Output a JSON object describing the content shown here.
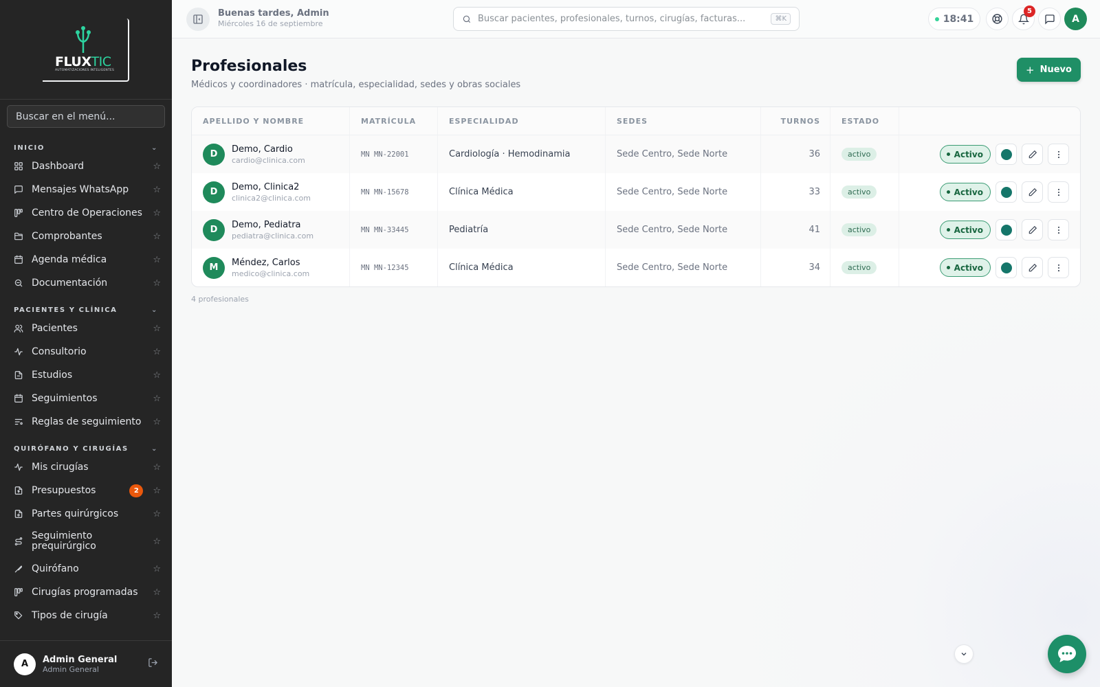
{
  "sidebar": {
    "logo": {
      "brand_a": "FLUX",
      "brand_b": "TIC",
      "tagline": "AUTOMATIZACIONES INTELIGENTES"
    },
    "menu_search_placeholder": "Buscar en el menú...",
    "sections": [
      {
        "title": "INICIO",
        "items": [
          {
            "label": "Dashboard",
            "icon": "grid-icon"
          },
          {
            "label": "Mensajes WhatsApp",
            "icon": "message-icon"
          },
          {
            "label": "Centro de Operaciones",
            "icon": "kanban-icon"
          },
          {
            "label": "Comprobantes",
            "icon": "folder-icon"
          },
          {
            "label": "Agenda médica",
            "icon": "calendar-icon"
          },
          {
            "label": "Documentación",
            "icon": "search-doc-icon"
          }
        ]
      },
      {
        "title": "PACIENTES Y CLÍNICA",
        "items": [
          {
            "label": "Pacientes",
            "icon": "users-icon"
          },
          {
            "label": "Consultorio",
            "icon": "pulse-icon"
          },
          {
            "label": "Estudios",
            "icon": "file-icon"
          },
          {
            "label": "Seguimientos",
            "icon": "calendar-icon"
          },
          {
            "label": "Reglas de seguimiento",
            "icon": "rules-icon"
          }
        ]
      },
      {
        "title": "QUIRÓFANO Y CIRUGÍAS",
        "items": [
          {
            "label": "Mis cirugías",
            "icon": "pulse-icon"
          },
          {
            "label": "Presupuestos",
            "icon": "file-dollar-icon",
            "badge": "2"
          },
          {
            "label": "Partes quirúrgicos",
            "icon": "file-plus-icon"
          },
          {
            "label": "Seguimiento prequirúrgico",
            "icon": "route-icon"
          },
          {
            "label": "Quirófano",
            "icon": "scalpel-icon"
          },
          {
            "label": "Cirugías programadas",
            "icon": "kanban-icon"
          },
          {
            "label": "Tipos de cirugía",
            "icon": "tag-icon"
          }
        ]
      }
    ],
    "user": {
      "initial": "A",
      "name": "Admin General",
      "role": "Admin General"
    }
  },
  "topbar": {
    "greeting": "Buenas tardes, Admin",
    "date": "Miércoles 16 de septiembre",
    "search_placeholder": "Buscar pacientes, profesionales, turnos, cirugías, facturas...",
    "search_shortcut": "⌘K",
    "time": "18:41",
    "notifications_count": "5",
    "avatar_initial": "A"
  },
  "page": {
    "title": "Profesionales",
    "subtitle": "Médicos y coordinadores · matrícula, especialidad, sedes y obras sociales",
    "new_button": "Nuevo",
    "columns": [
      "APELLIDO Y NOMBRE",
      "MATRÍCULA",
      "ESPECIALIDAD",
      "SEDES",
      "TURNOS",
      "ESTADO"
    ],
    "rows": [
      {
        "initial": "D",
        "name": "Demo, Cardio",
        "email": "cardio@clinica.com",
        "matricula": "MN MN-22001",
        "especialidad": "Cardiología · Hemodinamia",
        "sedes": "Sede Centro, Sede Norte",
        "turnos": "36",
        "estado": "activo",
        "toggle": "Activo"
      },
      {
        "initial": "D",
        "name": "Demo, Clinica2",
        "email": "clinica2@clinica.com",
        "matricula": "MN MN-15678",
        "especialidad": "Clínica Médica",
        "sedes": "Sede Centro, Sede Norte",
        "turnos": "33",
        "estado": "activo",
        "toggle": "Activo"
      },
      {
        "initial": "D",
        "name": "Demo, Pediatra",
        "email": "pediatra@clinica.com",
        "matricula": "MN MN-33445",
        "especialidad": "Pediatría",
        "sedes": "Sede Centro, Sede Norte",
        "turnos": "41",
        "estado": "activo",
        "toggle": "Activo"
      },
      {
        "initial": "M",
        "name": "Méndez, Carlos",
        "email": "medico@clinica.com",
        "matricula": "MN MN-12345",
        "especialidad": "Clínica Médica",
        "sedes": "Sede Centro, Sede Norte",
        "turnos": "34",
        "estado": "activo",
        "toggle": "Activo"
      }
    ],
    "count_note": "4 profesionales"
  },
  "colors": {
    "brand": "#1f8f66",
    "sidebar_bg": "#252525",
    "badge_orange": "#ea580c",
    "notif_red": "#dc2626",
    "professional_color": "#15766a"
  }
}
